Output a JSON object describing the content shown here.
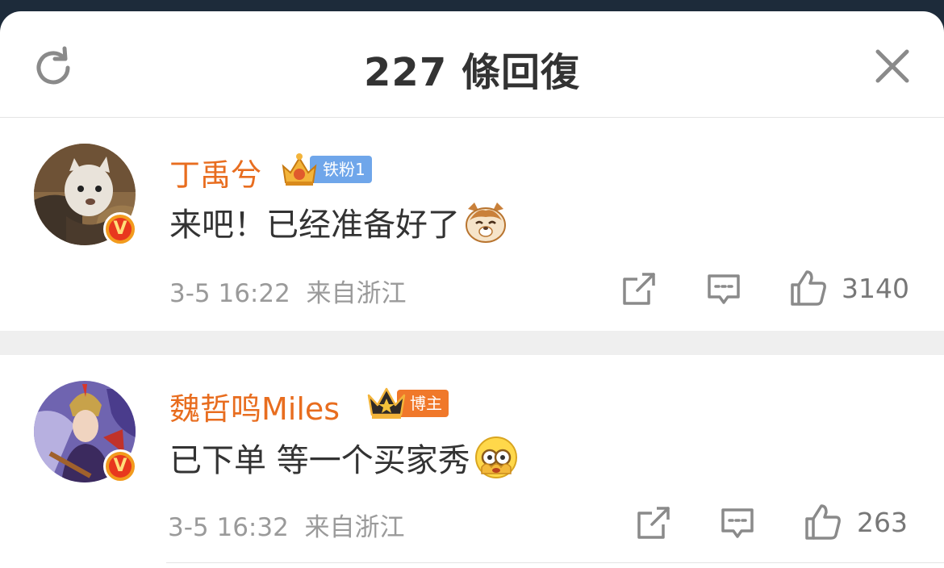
{
  "header": {
    "title": "227 條回復"
  },
  "comments": [
    {
      "username": "丁禹兮",
      "badge_text": "铁粉1",
      "badge_color": "#6fa6ea",
      "verified": "V",
      "text": "来吧！已经准备好了",
      "emoji": "cat-face-emoji",
      "time": "3-5 16:22",
      "source": "来自浙江",
      "likes": "3140"
    },
    {
      "username": "魏哲鸣Miles",
      "badge_text": "博主",
      "badge_color": "#f0782a",
      "verified": "V",
      "text": "已下单 等一个买家秀",
      "emoji": "peeking-face-emoji",
      "time": "3-5 16:32",
      "source": "来自浙江",
      "likes": "263"
    }
  ],
  "colors": {
    "username": "#e86d1f",
    "meta": "#9a9a9a",
    "divider": "#efefef"
  }
}
